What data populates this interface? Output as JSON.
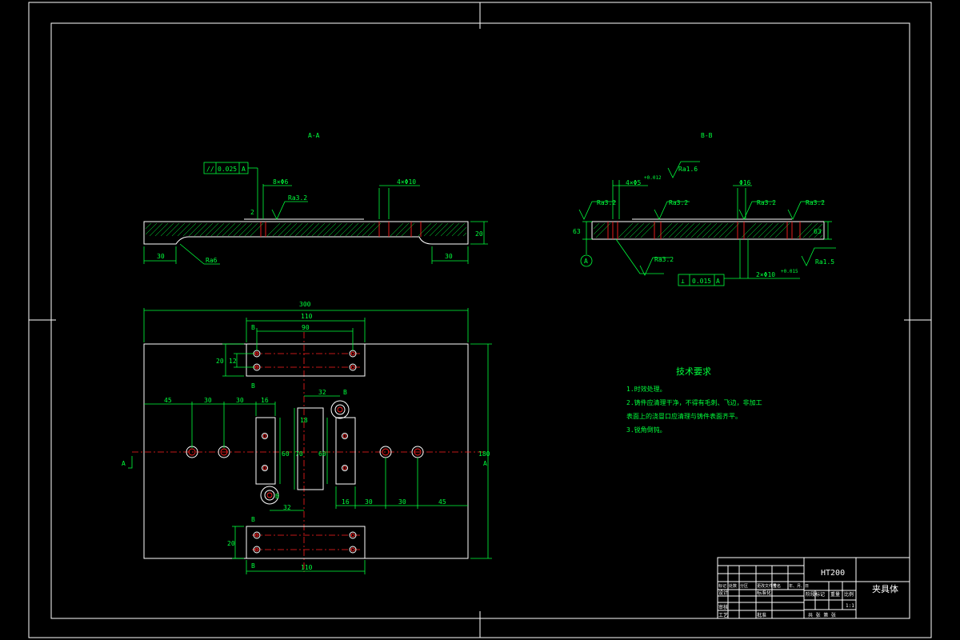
{
  "views": {
    "section_a": "A-A",
    "section_b": "B-B"
  },
  "section_a": {
    "parallelism": "//",
    "parallelism_value": "0.025",
    "datum": "A",
    "holes_left": "8×Φ6",
    "holes_right": "4×Φ10",
    "roughness": "Ra3.2",
    "roughness2": "Ra6",
    "dim_left": "30",
    "dim_right": "30",
    "dim_height": "20",
    "small_dim": "2"
  },
  "section_b": {
    "holes_4": "4×Φ5",
    "tol_4": "+0.012",
    "roughness_top": "Ra1.6",
    "roughness_left": "Ra3.2",
    "roughness_mid": "Ra3.2",
    "roughness_right_a": "Ra3.2",
    "roughness_right_b": "Ra3.2",
    "dia_16": "Φ16",
    "dim_left_h": "63",
    "dim_right_h": "63",
    "datum": "A",
    "perp": "⊥",
    "perp_value": "0.015",
    "perp_datum": "A",
    "holes_2": "2×Φ10",
    "tol_2": "+0.015",
    "roughness_bottom": "Ra1.5",
    "roughness_lower_left": "Ra3.2"
  },
  "plan": {
    "width": "300",
    "top_110": "110",
    "top_90": "90",
    "top_20": "20",
    "top_12": "12",
    "bottom_110": "110",
    "bottom_20": "20",
    "left_45": "45",
    "left_30a": "30",
    "left_30b": "30",
    "left_16": "16",
    "right_45": "45",
    "right_30a": "30",
    "right_30b": "30",
    "right_16": "16",
    "dim_32_top": "32",
    "dim_32_bottom": "32",
    "mark_b": "B",
    "mark_a": "A",
    "height": "180",
    "mid_60a": "60",
    "mid_60b": "60",
    "mid_70": "70",
    "mid_18": "18"
  },
  "tech": {
    "title": "技术要求",
    "items": [
      "1.时效处理。",
      "2.铸件应清理干净，不得有毛刺、飞边，非加工",
      "表面上的浇冒口应清理与铸件表面齐平。",
      "3.锐角倒钝。"
    ]
  },
  "title_block": {
    "material": "HT200",
    "part_name": "夹具体",
    "scale": "1:1",
    "row_labels": [
      "标记",
      "处数",
      "分区",
      "更改文件号",
      "签名",
      "年、月、日"
    ],
    "design": "设计",
    "standard": "标准化",
    "audit": "审核",
    "craft": "工艺",
    "approve": "批准",
    "stage_label": "阶段标记",
    "weight_label": "重量",
    "ratio_label": "比例",
    "sheets": "共    张   第    张"
  }
}
